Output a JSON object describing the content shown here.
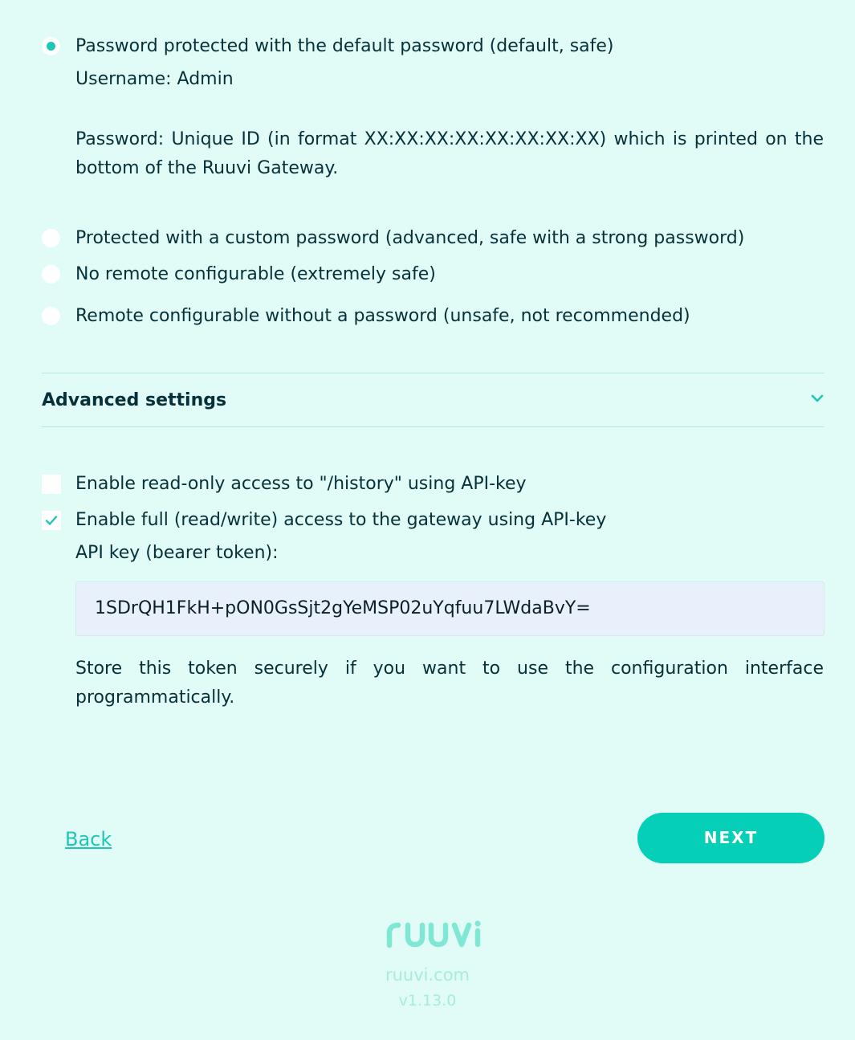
{
  "remote_access": {
    "options": [
      {
        "label": "Password protected with the default password (default, safe)",
        "selected": true
      },
      {
        "label": "Protected with a custom password (advanced, safe with a strong password)",
        "selected": false
      },
      {
        "label": "No remote configurable (extremely safe)",
        "selected": false
      },
      {
        "label": "Remote configurable without a password (unsafe, not recommended)",
        "selected": false
      }
    ],
    "username_text": "Username: Admin",
    "password_text": "Password: Unique ID (in format XX:XX:XX:XX:XX:XX:XX:XX) which is printed on the bottom of the Ruuvi Gateway."
  },
  "advanced": {
    "title": "Advanced settings",
    "chevron_icon": "chevron-down-icon",
    "checkboxes": [
      {
        "label": "Enable read-only access to \"/history\" using API-key",
        "checked": false
      },
      {
        "label": "Enable full (read/write) access to the gateway using API-key",
        "checked": true
      }
    ],
    "api_key_label": "API key (bearer token):",
    "api_key_value": "1SDrQH1FkH+pON0GsSjt2gYeMSP02uYqfuu7LWdaBvY=",
    "store_note": "Store this token securely if you want to use the configuration interface programmatically."
  },
  "nav": {
    "back_label": "Back",
    "next_label": "NEXT"
  },
  "footer": {
    "logo_text": "ruuvi",
    "site": "ruuvi.com",
    "version": "v1.13.0"
  },
  "colors": {
    "background": "#e1fcf6",
    "accent": "#06cfb8",
    "text": "#06313a",
    "footer_text": "#a6ecde"
  }
}
